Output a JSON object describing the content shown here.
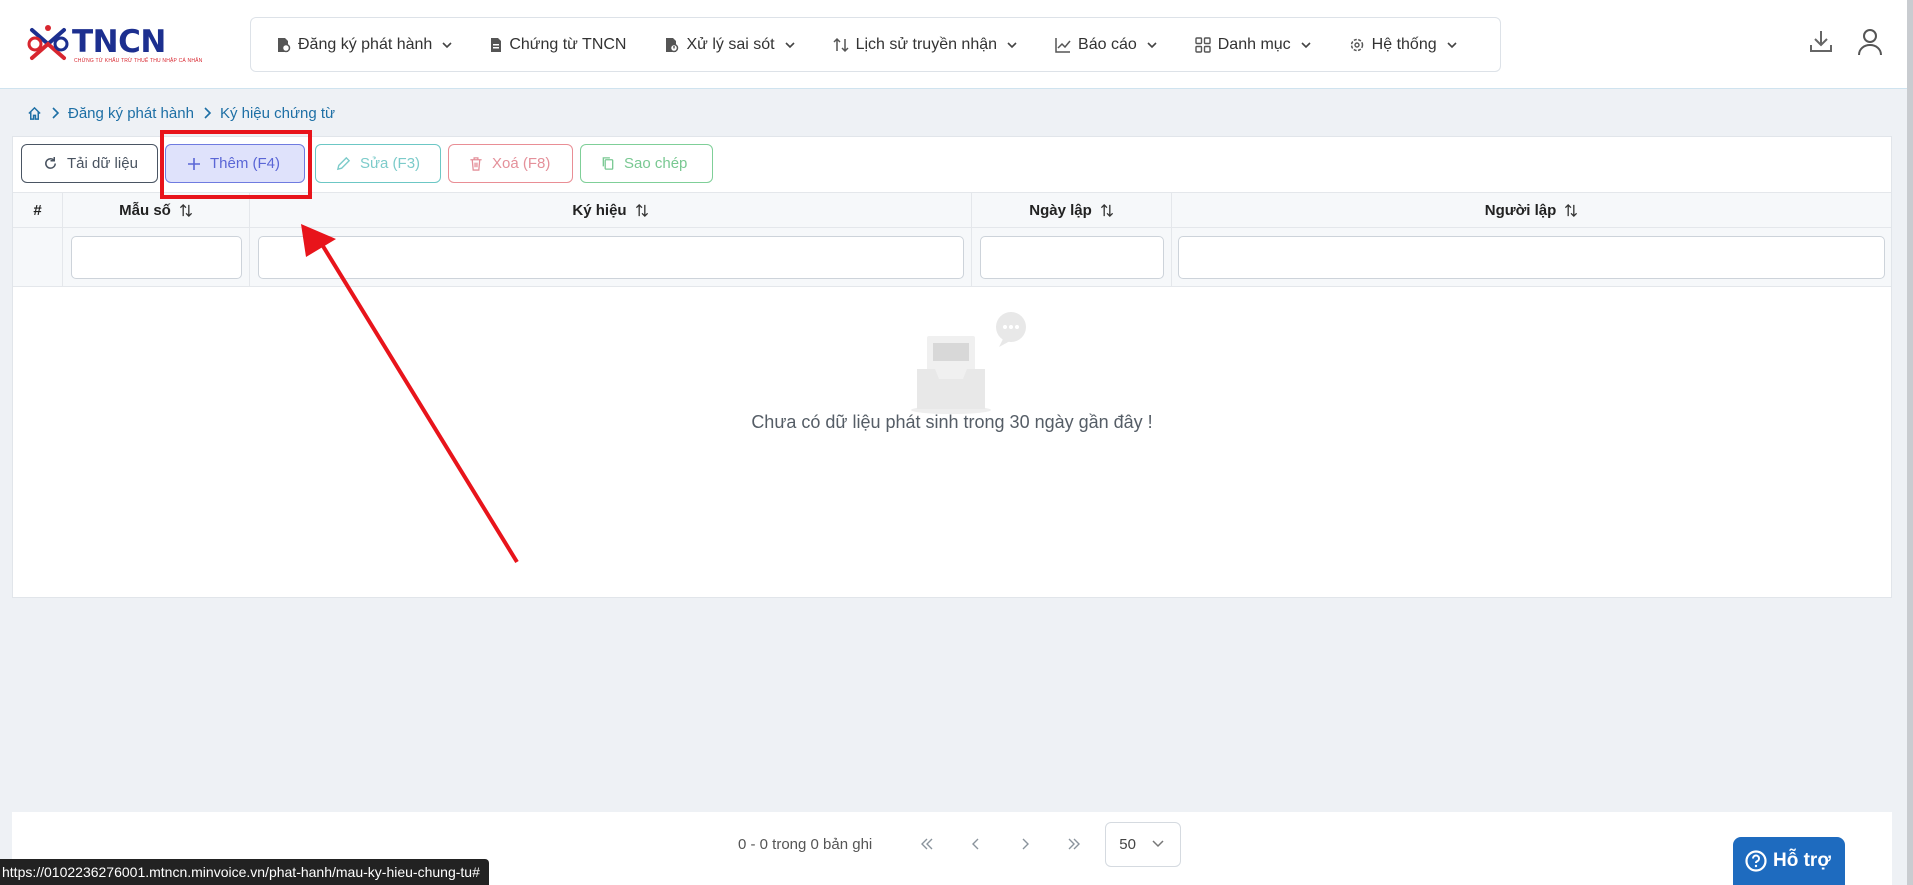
{
  "logo": {
    "text": "TNCN",
    "subtitle": "CHỨNG TỪ KHẤU TRỪ THUẾ THU NHẬP CÁ NHÂN"
  },
  "menu": [
    {
      "label": "Đăng ký phát hành",
      "icon": "file-gear-icon",
      "dropdown": true
    },
    {
      "label": "Chứng từ TNCN",
      "icon": "document-icon",
      "dropdown": false
    },
    {
      "label": "Xử lý sai sót",
      "icon": "file-alert-icon",
      "dropdown": true
    },
    {
      "label": "Lịch sử truyền nhận",
      "icon": "transfer-arrows-icon",
      "dropdown": true
    },
    {
      "label": "Báo cáo",
      "icon": "line-chart-icon",
      "dropdown": true
    },
    {
      "label": "Danh mục",
      "icon": "grid-icon",
      "dropdown": true
    },
    {
      "label": "Hệ thống",
      "icon": "gear-icon",
      "dropdown": true
    }
  ],
  "breadcrumb": {
    "level1": "Đăng ký phát hành",
    "level2": "Ký hiệu chứng từ"
  },
  "toolbar": {
    "reload": "Tải dữ liệu",
    "add": "Thêm (F4)",
    "edit": "Sửa (F3)",
    "delete": "Xoá (F8)",
    "copy": "Sao chép"
  },
  "table": {
    "columns": {
      "index": "#",
      "form_no": "Mẫu số",
      "symbol": "Ký hiệu",
      "created_date": "Ngày lập",
      "creator": "Người lập"
    },
    "empty_message": "Chưa có dữ liệu phát sinh trong 30 ngày gần đây !"
  },
  "pagination": {
    "info": "0 - 0 trong 0 bản ghi",
    "page_size": "50"
  },
  "status_url": "https://0102236276001.mtncn.minvoice.vn/phat-hanh/mau-ky-hieu-chung-tu#",
  "support": "Hỗ trợ",
  "colors": {
    "brand_blue": "#1c2f8f",
    "brand_red": "#d8262f",
    "annotation_red": "#e8141b",
    "link": "#1d6fa5",
    "support_bg": "#1e6bbf"
  }
}
